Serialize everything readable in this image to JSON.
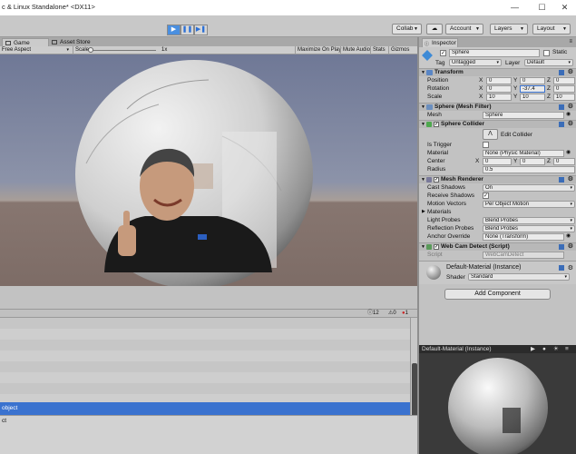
{
  "window": {
    "title": "c & Linux Standalone* <DX11>",
    "minimize_icon": "minimize-icon",
    "maximize_icon": "maximize-icon",
    "close_icon": "close-icon"
  },
  "toolbar": {
    "play_icon": "play-icon",
    "pause_icon": "pause-icon",
    "step_icon": "step-icon",
    "collab_label": "Collab",
    "cloud_icon": "cloud-icon",
    "account_label": "Account",
    "layers_label": "Layers",
    "layout_label": "Layout"
  },
  "game": {
    "tabs": [
      {
        "label": "Game",
        "icon": "game-icon"
      },
      {
        "label": "Asset Store",
        "icon": "store-icon"
      }
    ],
    "aspect_label": "Free Aspect",
    "scale_label": "Scale",
    "scale_value": "1x",
    "maximize_on_play": "Maximize On Play",
    "mute_audio": "Mute Audio",
    "stats": "Stats",
    "gizmos": "Gizmos"
  },
  "console": {
    "info_count": "12",
    "warning_count": "0",
    "error_count": "1",
    "selected_row_text": "object",
    "detail_text": "ct"
  },
  "inspector": {
    "tab_label": "Inspector",
    "object_name": "Sphere",
    "static_label": "Static",
    "tag_label": "Tag",
    "tag_value": "Untagged",
    "layer_label": "Layer",
    "layer_value": "Default",
    "transform": {
      "title": "Transform",
      "position_label": "Position",
      "rotation_label": "Rotation",
      "scale_label": "Scale",
      "position": [
        "0",
        "0",
        "0"
      ],
      "rotation": [
        "0",
        "-37.4",
        "0"
      ],
      "scale": [
        "10",
        "10",
        "10"
      ]
    },
    "mesh_filter": {
      "title": "Sphere (Mesh Filter)",
      "mesh_label": "Mesh",
      "mesh_value": "Sphere"
    },
    "sphere_collider": {
      "title": "Sphere Collider",
      "edit_collider_label": "Edit Collider",
      "is_trigger_label": "Is Trigger",
      "material_label": "Material",
      "material_value": "None (Physic Material)",
      "center_label": "Center",
      "center": [
        "0",
        "0",
        "0"
      ],
      "radius_label": "Radius",
      "radius_value": "0.5"
    },
    "mesh_renderer": {
      "title": "Mesh Renderer",
      "cast_shadows_label": "Cast Shadows",
      "cast_shadows_value": "On",
      "receive_shadows_label": "Receive Shadows",
      "motion_vectors_label": "Motion Vectors",
      "motion_vectors_value": "Per Object Motion",
      "materials_label": "Materials",
      "light_probes_label": "Light Probes",
      "light_probes_value": "Blend Probes",
      "reflection_probes_label": "Reflection Probes",
      "reflection_probes_value": "Blend Probes",
      "anchor_override_label": "Anchor Override",
      "anchor_override_value": "None (Transform)"
    },
    "webcam": {
      "title": "Web Cam Detect (Script)",
      "script_label": "Script",
      "script_value": "WebCamDetect"
    },
    "material": {
      "name": "Default-Material (Instance)",
      "shader_label": "Shader",
      "shader_value": "Standard"
    },
    "add_component_label": "Add Component",
    "preview_title": "Default-Material (Instance)"
  },
  "colors": {
    "accent": "#3a72cf",
    "play_active": "#4a8fe0"
  }
}
